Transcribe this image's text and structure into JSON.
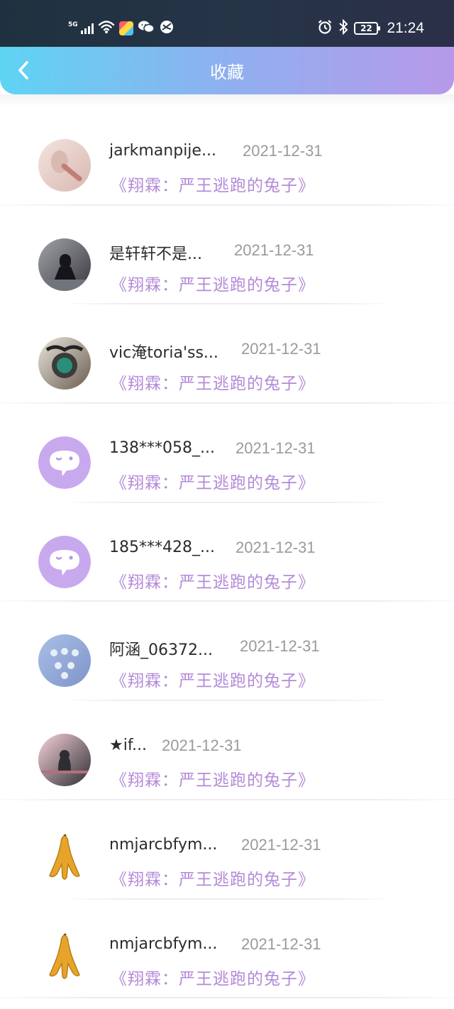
{
  "status_bar": {
    "network": "5G",
    "time": "21:24",
    "battery": "22",
    "left_icons": [
      "signal-icon",
      "wifi-icon",
      "app-icon",
      "wechat-icon",
      "browser-icon"
    ],
    "right_icons": [
      "alarm-icon",
      "bluetooth-icon",
      "battery-icon"
    ]
  },
  "header": {
    "title": "收藏",
    "back_icon": "chevron-left-icon",
    "gradient": [
      "#5ed4f3",
      "#b799ea"
    ]
  },
  "colors": {
    "work_title": "#b48ad8",
    "date": "#9a9a9a"
  },
  "favorites": [
    {
      "name": "jarkmanpije...",
      "date": "2021-12-31",
      "work": "《翔霖：严王逃跑的兔子》",
      "avatar": "photo-avatar"
    },
    {
      "name": "是轩轩不是...",
      "date": "2021-12-31",
      "work": "《翔霖：严王逃跑的兔子》",
      "avatar": "photo-avatar"
    },
    {
      "name": "vic淹toria'ss...",
      "date": "2021-12-31",
      "work": "《翔霖：严王逃跑的兔子》",
      "avatar": "photo-avatar"
    },
    {
      "name": "138***058_...",
      "date": "2021-12-31",
      "work": "《翔霖：严王逃跑的兔子》",
      "avatar": "default-chat-avatar"
    },
    {
      "name": "185***428_...",
      "date": "2021-12-31",
      "work": "《翔霖：严王逃跑的兔子》",
      "avatar": "default-chat-avatar"
    },
    {
      "name": "阿涵_06372...",
      "date": "2021-12-31",
      "work": "《翔霖：严王逃跑的兔子》",
      "avatar": "photo-avatar"
    },
    {
      "name": "★if...",
      "date": "2021-12-31",
      "work": "《翔霖：严王逃跑的兔子》",
      "avatar": "photo-avatar"
    },
    {
      "name": "nmjarcbfym...",
      "date": "2021-12-31",
      "work": "《翔霖：严王逃跑的兔子》",
      "avatar": "banana-avatar"
    },
    {
      "name": "nmjarcbfym...",
      "date": "2021-12-31",
      "work": "《翔霖：严王逃跑的兔子》",
      "avatar": "banana-avatar"
    }
  ]
}
